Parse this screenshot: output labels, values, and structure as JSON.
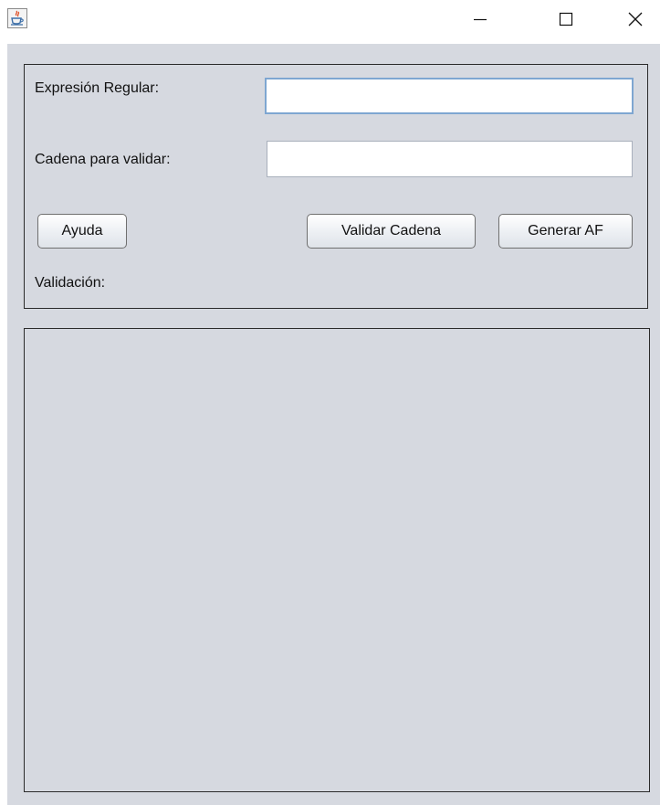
{
  "window": {
    "minimize_glyph": "—",
    "maximize_glyph": "☐",
    "close_glyph": "✕"
  },
  "form": {
    "regex_label": "Expresión Regular:",
    "regex_value": "",
    "string_label": "Cadena para validar:",
    "string_value": "",
    "help_button": "Ayuda",
    "validate_button": "Validar Cadena",
    "generate_button": "Generar AF",
    "validation_label": "Validación:"
  },
  "colors": {
    "background": "#d6d9e0",
    "focus_border": "#7ea6d1",
    "panel_border": "#2b2b2b"
  },
  "icons": {
    "app": "java-coffee-cup-icon"
  }
}
